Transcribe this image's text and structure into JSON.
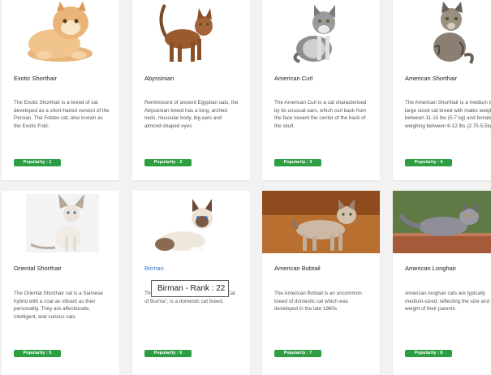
{
  "cats": [
    {
      "name": "Exotic Shorthair",
      "description": "The Exotic Shorthair is a breed of cat developed as a short-haired version of the Persian. The Foldex cat, also known as the Exotic Fold.",
      "popularity": "Popularity : 1",
      "image": "orange-persian-cat"
    },
    {
      "name": "Abyssinian",
      "description": "Reminiscent of ancient Egyptian cats, the Abyssinian breed has a long, arched neck, muscular body, big ears and almond-shaped eyes",
      "popularity": "Popularity : 2",
      "image": "ruddy-abyssinian-cat"
    },
    {
      "name": "American Curl",
      "description": "The American Curl is a cat characterised by its unusual ears, which curl back from the face toward the center of the back of the skull.",
      "popularity": "Popularity : 3",
      "image": "tabby-curl-cat"
    },
    {
      "name": "American Shorthair",
      "description": "The American Shorthair is a medium to large sized cat breed with males weighing between 11-15 lbs (5-7 kg) and females weighing between 6-12 lbs (2.75-5.5kg).",
      "popularity": "Popularity : 4",
      "image": "silver-tabby-cat"
    },
    {
      "name": "Oriental Shorthair",
      "description": "The Oriental Shorthair cat is a Siamese hybrid with a coat as vibrant as their personality. They are affectionate, intelligent, and curious cats",
      "popularity": "Popularity : 5",
      "image": "oriental-siamese-cat"
    },
    {
      "name": "Birman",
      "description": "The Birman, also called the \"Sacred Cat of Burma\", is a domestic cat breed.",
      "popularity": "Popularity : 6",
      "image": "birman-cat"
    },
    {
      "name": "American Bobtail",
      "description": "The American Bobtail is an uncommon breed of domestic cat which was developed in the late 1960s",
      "popularity": "Popularity : 7",
      "image": "bobtail-cat"
    },
    {
      "name": "American Longhair",
      "description": "American longhair cats are typically medium-sized, reflecting the size and weight of their parents",
      "popularity": "Popularity : 8",
      "image": "grey-longhair-cat"
    }
  ],
  "tooltip": {
    "text": "Birman - Rank : 22"
  },
  "colors": {
    "badge": "#2e9e43",
    "link": "#3b73c8"
  }
}
